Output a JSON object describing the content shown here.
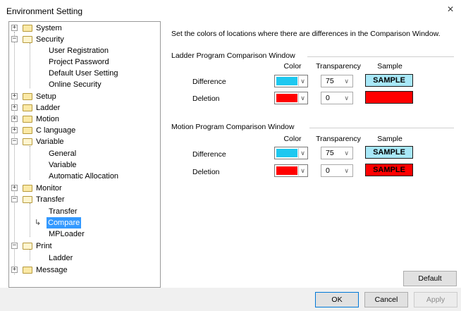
{
  "window": {
    "title": "Environment Setting",
    "close_glyph": "×"
  },
  "tree": {
    "items": [
      {
        "label": "System",
        "expander": "+"
      },
      {
        "label": "Security",
        "expander": "−"
      },
      {
        "label": "User Registration"
      },
      {
        "label": "Project Password"
      },
      {
        "label": "Default User Setting"
      },
      {
        "label": "Online Security"
      },
      {
        "label": "Setup",
        "expander": "+"
      },
      {
        "label": "Ladder",
        "expander": "+"
      },
      {
        "label": "Motion",
        "expander": "+"
      },
      {
        "label": "C language",
        "expander": "+"
      },
      {
        "label": "Variable",
        "expander": "−"
      },
      {
        "label": "General"
      },
      {
        "label": "Variable"
      },
      {
        "label": "Automatic Allocation"
      },
      {
        "label": "Monitor",
        "expander": "+"
      },
      {
        "label": "Transfer",
        "expander": "−"
      },
      {
        "label": "Transfer"
      },
      {
        "label": "Compare",
        "selected": true
      },
      {
        "label": "MPLoader"
      },
      {
        "label": "Print",
        "expander": "−"
      },
      {
        "label": "Ladder"
      },
      {
        "label": "Message",
        "expander": "+"
      }
    ]
  },
  "main": {
    "intro": "Set the colors of locations where there are differences in the Comparison Window.",
    "ladder": {
      "title": "Ladder Program Comparison Window",
      "columns": {
        "color": "Color",
        "transparency": "Transparency",
        "sample": "Sample"
      },
      "rows": [
        {
          "label": "Difference",
          "color": "#1ec8f0",
          "transparency": "75",
          "sample_text": "SAMPLE",
          "sample_bg": "#a8e8f8",
          "sample_fg": "#000000"
        },
        {
          "label": "Deletion",
          "color": "#ff0000",
          "transparency": "0",
          "sample_text": "",
          "sample_bg": "#ff0000",
          "sample_fg": "#000000"
        }
      ]
    },
    "motion": {
      "title": "Motion Program Comparison Window",
      "columns": {
        "color": "Color",
        "transparency": "Transparency",
        "sample": "Sample"
      },
      "rows": [
        {
          "label": "Difference",
          "color": "#1ec8f0",
          "transparency": "75",
          "sample_text": "SAMPLE",
          "sample_bg": "#a8e8f8",
          "sample_fg": "#000000"
        },
        {
          "label": "Deletion",
          "color": "#ff0000",
          "transparency": "0",
          "sample_text": "SAMPLE",
          "sample_bg": "#ff0000",
          "sample_fg": "#000000"
        }
      ]
    },
    "default_label": "Default"
  },
  "footer": {
    "ok_label": "OK",
    "cancel_label": "Cancel",
    "apply_label": "Apply"
  },
  "glyphs": {
    "dropdown": "∨",
    "caret": "⌵",
    "arrow": "↳"
  }
}
